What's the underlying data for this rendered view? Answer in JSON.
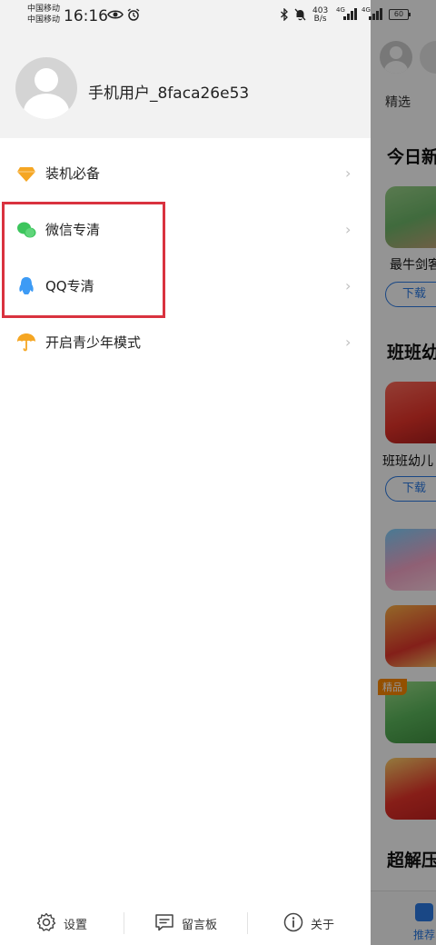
{
  "status_bar": {
    "carrier_1": "中国移动",
    "carrier_2": "中国移动",
    "time": "16:16",
    "net_speed_value": "403",
    "net_speed_unit": "B/s",
    "signal_1_type": "4G",
    "signal_2_type": "4G",
    "battery": "60"
  },
  "drawer": {
    "user_name": "手机用户_8faca26e53",
    "menu_items": [
      {
        "label": "装机必备",
        "icon": "diamond-icon",
        "color": "#f5a623"
      },
      {
        "label": "微信专清",
        "icon": "wechat-icon",
        "color": "#3cc55c"
      },
      {
        "label": "QQ专清",
        "icon": "qq-penguin-icon",
        "color": "#3d9bf5"
      },
      {
        "label": "开启青少年模式",
        "icon": "umbrella-icon",
        "color": "#f5a623"
      }
    ],
    "chevron": "›",
    "footer": {
      "settings_label": "设置",
      "message_board_label": "留言板",
      "about_label": "关于"
    }
  },
  "background_app": {
    "tab_label": "精选",
    "sections": [
      "今日新",
      "班班幼",
      "超解压"
    ],
    "apps": [
      "最牛剑客",
      "班班幼儿"
    ],
    "download_label": "下载",
    "badge_label": "精品",
    "nav_label": "推荐"
  },
  "colors": {
    "highlight_border": "#d9323f",
    "accent_blue": "#2b7be6"
  }
}
